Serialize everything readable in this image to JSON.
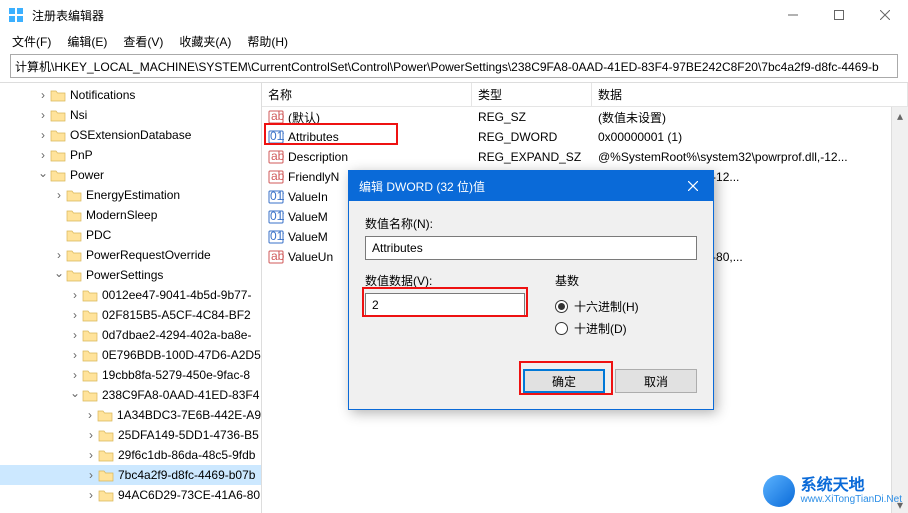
{
  "window": {
    "title": "注册表编辑器"
  },
  "menu": {
    "file": "文件(F)",
    "edit": "编辑(E)",
    "view": "查看(V)",
    "favorites": "收藏夹(A)",
    "help": "帮助(H)"
  },
  "address": "计算机\\HKEY_LOCAL_MACHINE\\SYSTEM\\CurrentControlSet\\Control\\Power\\PowerSettings\\238C9FA8-0AAD-41ED-83F4-97BE242C8F20\\7bc4a2f9-d8fc-4469-b",
  "tree": [
    {
      "indent": 2,
      "twisty": ">",
      "label": "Notifications"
    },
    {
      "indent": 2,
      "twisty": ">",
      "label": "Nsi"
    },
    {
      "indent": 2,
      "twisty": ">",
      "label": "OSExtensionDatabase"
    },
    {
      "indent": 2,
      "twisty": ">",
      "label": "PnP"
    },
    {
      "indent": 2,
      "twisty": "v",
      "label": "Power"
    },
    {
      "indent": 3,
      "twisty": ">",
      "label": "EnergyEstimation"
    },
    {
      "indent": 3,
      "twisty": "",
      "label": "ModernSleep"
    },
    {
      "indent": 3,
      "twisty": "",
      "label": "PDC"
    },
    {
      "indent": 3,
      "twisty": ">",
      "label": "PowerRequestOverride"
    },
    {
      "indent": 3,
      "twisty": "v",
      "label": "PowerSettings"
    },
    {
      "indent": 4,
      "twisty": ">",
      "label": "0012ee47-9041-4b5d-9b77-"
    },
    {
      "indent": 4,
      "twisty": ">",
      "label": "02F815B5-A5CF-4C84-BF2"
    },
    {
      "indent": 4,
      "twisty": ">",
      "label": "0d7dbae2-4294-402a-ba8e-"
    },
    {
      "indent": 4,
      "twisty": ">",
      "label": "0E796BDB-100D-47D6-A2D5"
    },
    {
      "indent": 4,
      "twisty": ">",
      "label": "19cbb8fa-5279-450e-9fac-8"
    },
    {
      "indent": 4,
      "twisty": "v",
      "label": "238C9FA8-0AAD-41ED-83F4"
    },
    {
      "indent": 5,
      "twisty": ">",
      "label": "1A34BDC3-7E6B-442E-A9"
    },
    {
      "indent": 5,
      "twisty": ">",
      "label": "25DFA149-5DD1-4736-B5"
    },
    {
      "indent": 5,
      "twisty": ">",
      "label": "29f6c1db-86da-48c5-9fdb"
    },
    {
      "indent": 5,
      "twisty": ">",
      "label": "7bc4a2f9-d8fc-4469-b07b",
      "selected": true
    },
    {
      "indent": 5,
      "twisty": ">",
      "label": "94AC6D29-73CE-41A6-80"
    }
  ],
  "listHeader": {
    "name": "名称",
    "type": "类型",
    "data": "数据"
  },
  "values": [
    {
      "icon": "str",
      "name": "(默认)",
      "type": "REG_SZ",
      "data": "(数值未设置)"
    },
    {
      "icon": "bin",
      "name": "Attributes",
      "type": "REG_DWORD",
      "data": "0x00000001 (1)",
      "hl": true
    },
    {
      "icon": "str",
      "name": "Description",
      "type": "REG_EXPAND_SZ",
      "data": "@%SystemRoot%\\system32\\powrprof.dll,-12..."
    },
    {
      "icon": "str",
      "name": "FriendlyN",
      "type": "",
      "data": "ystem32\\powrprof.dll,-12..."
    },
    {
      "icon": "bin",
      "name": "ValueIn",
      "type": "",
      "data": ""
    },
    {
      "icon": "bin",
      "name": "ValueM",
      "type": "",
      "data": ""
    },
    {
      "icon": "bin",
      "name": "ValueM",
      "type": "",
      "data": ""
    },
    {
      "icon": "str",
      "name": "ValueUn",
      "type": "",
      "data": "ystem32\\powrprof.dll,-80,..."
    }
  ],
  "dialog": {
    "title": "编辑 DWORD (32 位)值",
    "nameLabel": "数值名称(N):",
    "nameValue": "Attributes",
    "dataLabel": "数值数据(V):",
    "dataValue": "2",
    "baseLabel": "基数",
    "radioHex": "十六进制(H)",
    "radioDec": "十进制(D)",
    "ok": "确定",
    "cancel": "取消"
  },
  "watermark": {
    "name": "系统天地",
    "url": "www.XiTongTianDi.Net"
  }
}
